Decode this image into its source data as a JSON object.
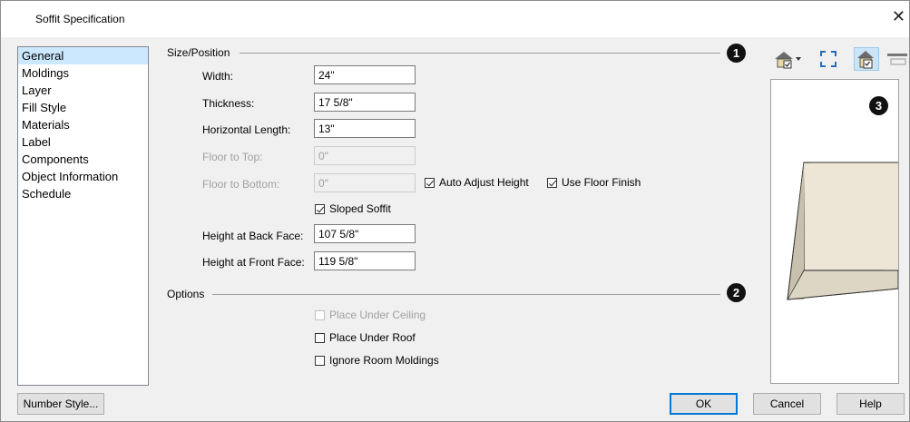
{
  "window": {
    "title": "Soffit Specification",
    "close_glyph": "✕"
  },
  "nav": {
    "items": [
      "General",
      "Moldings",
      "Layer",
      "Fill Style",
      "Materials",
      "Label",
      "Components",
      "Object Information",
      "Schedule"
    ],
    "selected": 0
  },
  "size_position": {
    "group_label": "Size/Position",
    "badge": "1",
    "width": {
      "label": "Width:",
      "value": "24\""
    },
    "thickness": {
      "label": "Thickness:",
      "value": "17 5/8\""
    },
    "horizontal_length": {
      "label": "Horizontal Length:",
      "value": "13\""
    },
    "floor_to_top": {
      "label": "Floor to Top:",
      "value": "0\""
    },
    "floor_to_bottom": {
      "label": "Floor to Bottom:",
      "value": "0\""
    },
    "auto_adjust_height": {
      "label": "Auto Adjust Height",
      "checked": true
    },
    "use_floor_finish": {
      "label": "Use Floor Finish",
      "checked": true
    },
    "sloped_soffit": {
      "label": "Sloped Soffit",
      "checked": true
    },
    "height_back": {
      "label": "Height at Back Face:",
      "value": "107 5/8\""
    },
    "height_front": {
      "label": "Height at Front Face:",
      "value": "119 5/8\""
    }
  },
  "options": {
    "group_label": "Options",
    "badge": "2",
    "place_under_ceiling": {
      "label": "Place Under Ceiling",
      "checked": false,
      "disabled": true
    },
    "place_under_roof": {
      "label": "Place Under Roof",
      "checked": false
    },
    "ignore_room_moldings": {
      "label": "Ignore Room Moldings",
      "checked": false
    }
  },
  "preview": {
    "badge": "3",
    "toolbar_icons": [
      "view-type-icon",
      "fill-window-icon",
      "preview-render-icon",
      "preview-options-icon"
    ]
  },
  "buttons": {
    "number_style": "Number Style...",
    "ok": "OK",
    "cancel": "Cancel",
    "help": "Help"
  },
  "colors": {
    "selection": "#cce8ff",
    "default_button_border": "#0078d7",
    "soffit_fill": "#ede6d6"
  }
}
